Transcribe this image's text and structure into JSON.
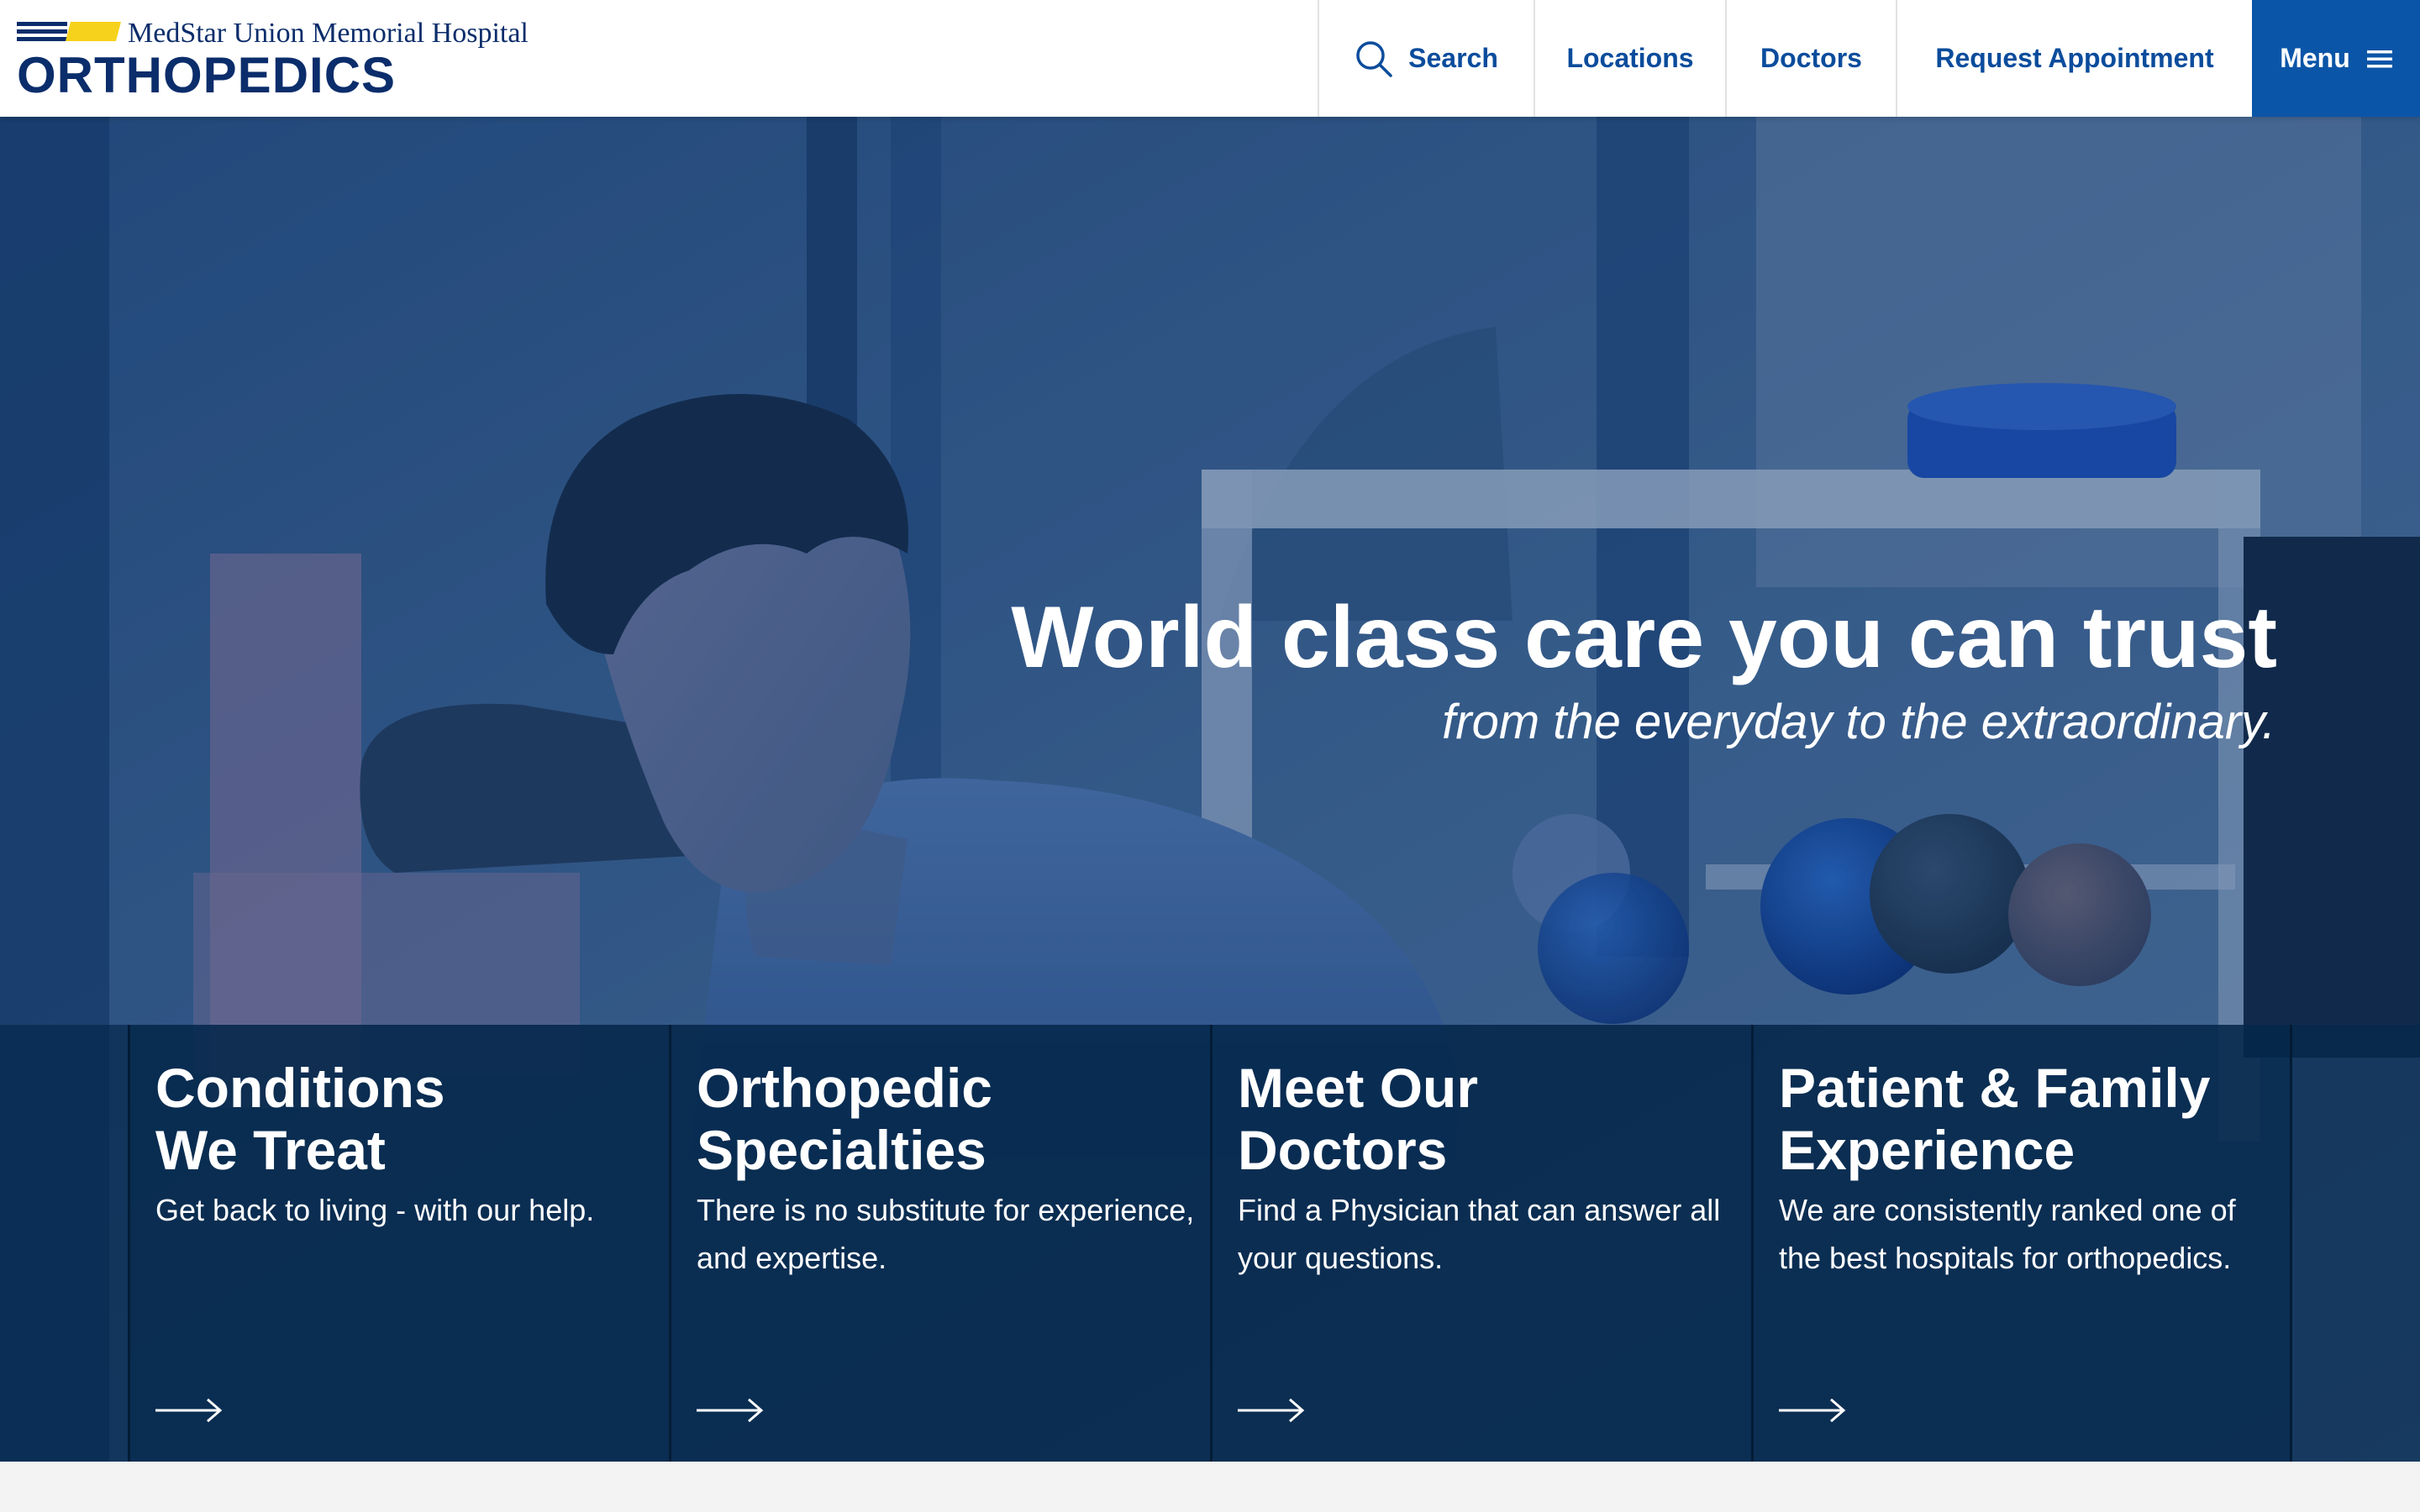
{
  "logo": {
    "hospital": "MedStar Union Memorial Hospital",
    "department": "ORTHOPEDICS",
    "colors": {
      "navy": "#0b2d6b",
      "yellow": "#f7d21c"
    }
  },
  "nav": {
    "search_label": "Search",
    "search_icon": "search-icon",
    "locations_label": "Locations",
    "doctors_label": "Doctors",
    "request_label": "Request Appointment",
    "menu_label": "Menu",
    "menu_icon": "hamburger-icon",
    "colors": {
      "link": "#0b4c9c",
      "menu_bg": "#0b55a8"
    }
  },
  "hero": {
    "title": "World class care you can trust",
    "subtitle": "from the everyday to the extraordinary."
  },
  "cards": [
    {
      "title_line1": "Conditions",
      "title_line2": "We Treat",
      "description": "Get back to living - with our help.",
      "icon": "arrow-right-icon"
    },
    {
      "title_line1": "Orthopedic",
      "title_line2": "Specialties",
      "description": "There is no substitute for experience, and expertise.",
      "icon": "arrow-right-icon"
    },
    {
      "title_line1": "Meet Our",
      "title_line2": "Doctors",
      "description": "Find a Physician that can answer all your questions.",
      "icon": "arrow-right-icon"
    },
    {
      "title_line1": "Patient & Family",
      "title_line2": "Experience",
      "description": "We are consistently ranked one of the best hospitals for orthopedics.",
      "icon": "arrow-right-icon"
    }
  ]
}
